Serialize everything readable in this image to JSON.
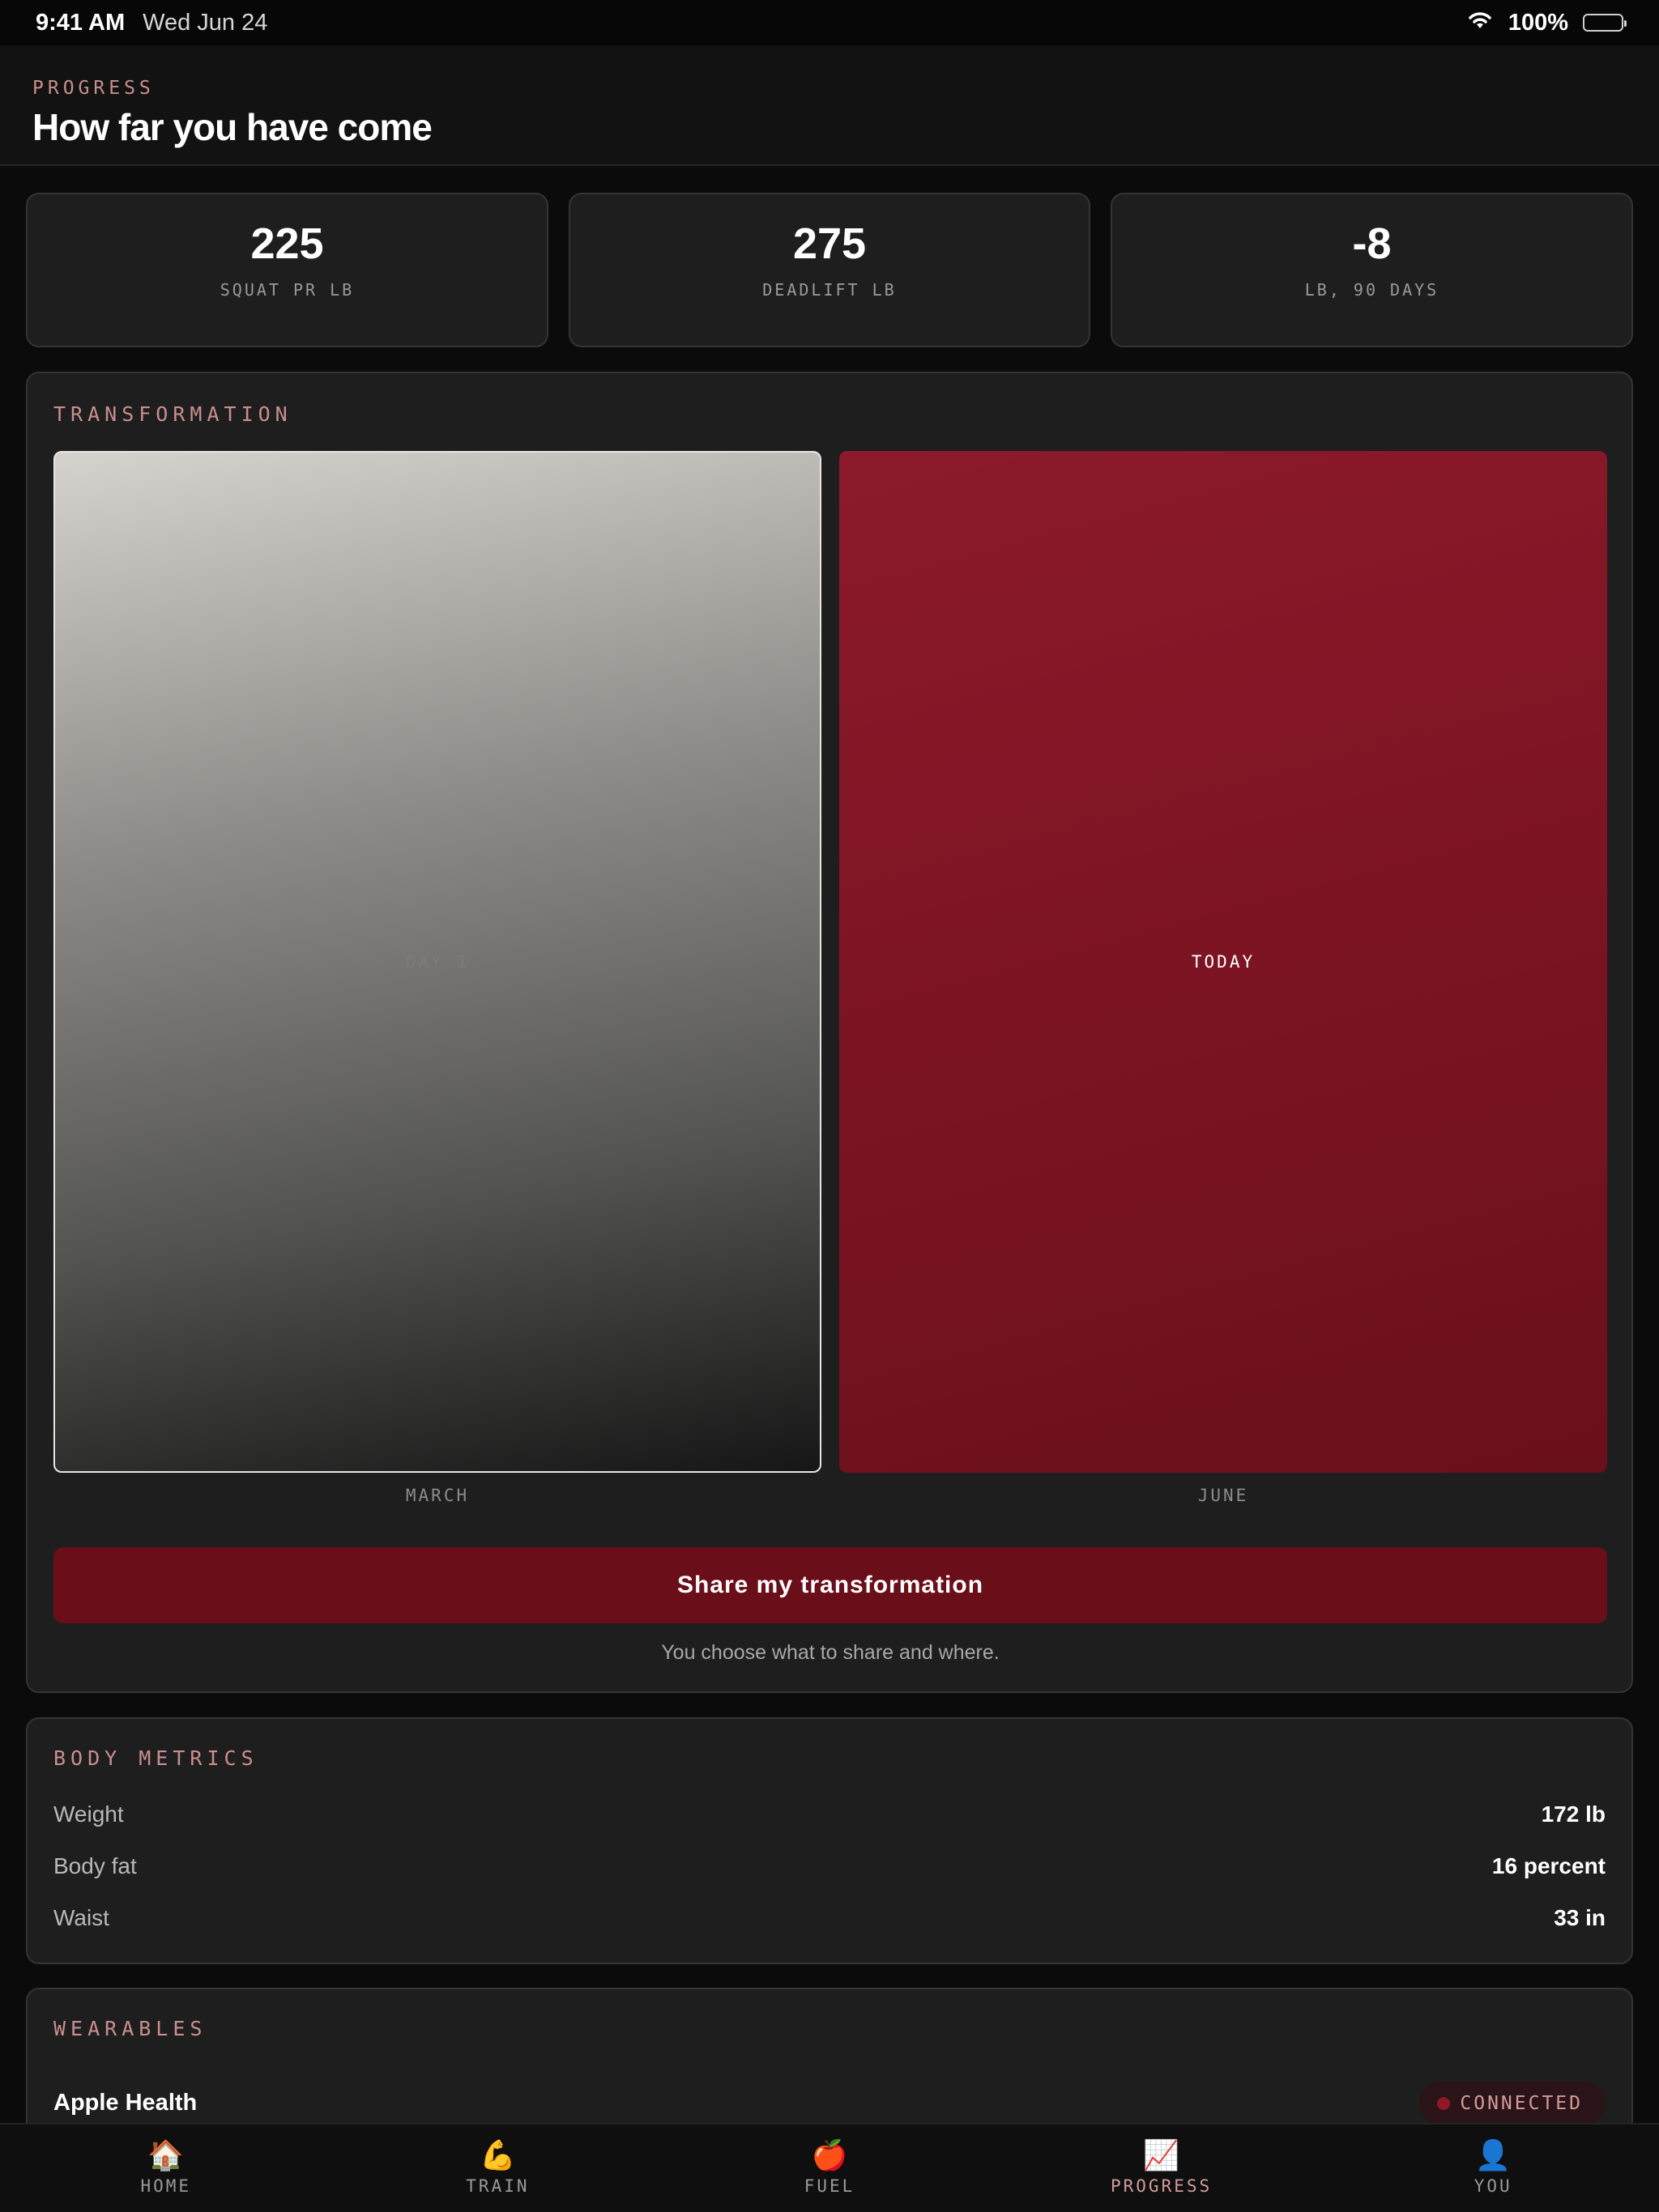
{
  "status_bar": {
    "time": "9:41 AM",
    "date": "Wed Jun 24",
    "battery": "100%",
    "wifi_icon": "wifi-icon",
    "battery_icon": "battery-icon"
  },
  "header": {
    "eyebrow": "PROGRESS",
    "title": "How far you have come"
  },
  "stats": [
    {
      "value": "225",
      "label": "SQUAT PR LB"
    },
    {
      "value": "275",
      "label": "DEADLIFT LB"
    },
    {
      "value": "-8",
      "label": "LB, 90 DAYS"
    }
  ],
  "transformation": {
    "label": "TRANSFORMATION",
    "before": {
      "tag": "DAY 1",
      "caption": "MARCH"
    },
    "after": {
      "tag": "TODAY",
      "caption": "JUNE"
    },
    "share_button": "Share my transformation",
    "share_note": "You choose what to share and where."
  },
  "body_metrics": {
    "label": "BODY METRICS",
    "rows": [
      {
        "name": "Weight",
        "value": "172 lb"
      },
      {
        "name": "Body fat",
        "value": "16 percent"
      },
      {
        "name": "Waist",
        "value": "33 in"
      }
    ]
  },
  "wearables": {
    "label": "WEARABLES",
    "items": [
      {
        "name": "Apple Health",
        "status": "CONNECTED"
      }
    ]
  },
  "tabs": [
    {
      "label": "HOME",
      "icon": "🏠",
      "icon_name": "house-icon"
    },
    {
      "label": "TRAIN",
      "icon": "💪",
      "icon_name": "flexed-biceps-icon"
    },
    {
      "label": "FUEL",
      "icon": "🍎",
      "icon_name": "apple-icon"
    },
    {
      "label": "PROGRESS",
      "icon": "📈",
      "icon_name": "chart-increasing-icon",
      "active": true
    },
    {
      "label": "YOU",
      "icon": "👤",
      "icon_name": "person-silhouette-icon"
    }
  ],
  "colors": {
    "accent": "#6a0e19",
    "accent_label": "#c98e8e",
    "background": "#0b0b0b",
    "card": "#1e1e1e"
  }
}
